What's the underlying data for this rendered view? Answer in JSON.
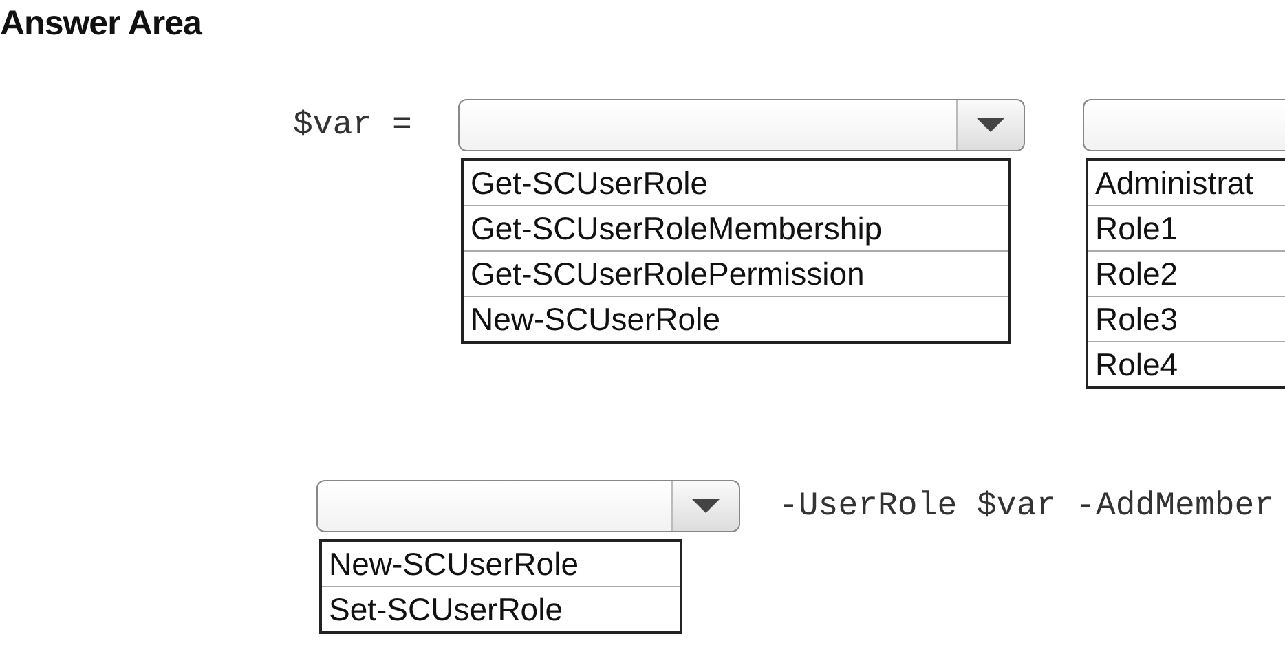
{
  "title": "Answer Area",
  "statements": [
    {
      "prefix": "$var =",
      "dropdowns": [
        {
          "options": [
            "Get-SCUserRole",
            "Get-SCUserRoleMembership",
            "Get-SCUserRolePermission",
            "New-SCUserRole"
          ]
        },
        {
          "options": [
            "Administrat",
            "Role1",
            "Role2",
            "Role3",
            "Role4"
          ]
        }
      ]
    },
    {
      "dropdowns": [
        {
          "options": [
            "New-SCUserRole",
            "Set-SCUserRole"
          ]
        }
      ],
      "suffix": "-UserRole $var -AddMember"
    }
  ]
}
